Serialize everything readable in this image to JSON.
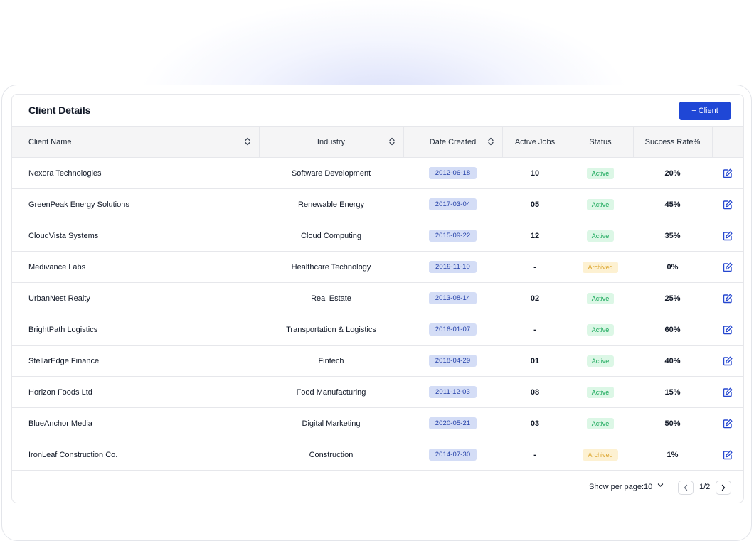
{
  "card": {
    "title": "Client Details",
    "add_button_label": "+ Client"
  },
  "columns": [
    "Client Name",
    "Industry",
    "Date Created",
    "Active Jobs",
    "Status",
    "Success Rate%"
  ],
  "rows": [
    {
      "name": "Nexora Technologies",
      "industry": "Software Development",
      "date": "2012-06-18",
      "jobs": "10",
      "status": "Active",
      "rate": "20%"
    },
    {
      "name": "GreenPeak Energy Solutions",
      "industry": "Renewable Energy",
      "date": "2017-03-04",
      "jobs": "05",
      "status": "Active",
      "rate": "45%"
    },
    {
      "name": "CloudVista Systems",
      "industry": "Cloud Computing",
      "date": "2015-09-22",
      "jobs": "12",
      "status": "Active",
      "rate": "35%"
    },
    {
      "name": "Medivance Labs",
      "industry": "Healthcare Technology",
      "date": "2019-11-10",
      "jobs": "-",
      "status": "Archived",
      "rate": "0%"
    },
    {
      "name": "UrbanNest Realty",
      "industry": "Real Estate",
      "date": "2013-08-14",
      "jobs": "02",
      "status": "Active",
      "rate": "25%"
    },
    {
      "name": "BrightPath Logistics",
      "industry": "Transportation & Logistics",
      "date": "2016-01-07",
      "jobs": "-",
      "status": "Active",
      "rate": "60%"
    },
    {
      "name": "StellarEdge Finance",
      "industry": "Fintech",
      "date": "2018-04-29",
      "jobs": "01",
      "status": "Active",
      "rate": "40%"
    },
    {
      "name": "Horizon Foods Ltd",
      "industry": "Food Manufacturing",
      "date": "2011-12-03",
      "jobs": "08",
      "status": "Active",
      "rate": "15%"
    },
    {
      "name": "BlueAnchor Media",
      "industry": "Digital Marketing",
      "date": "2020-05-21",
      "jobs": "03",
      "status": "Active",
      "rate": "50%"
    },
    {
      "name": "IronLeaf Construction Co.",
      "industry": "Construction",
      "date": "2014-07-30",
      "jobs": "-",
      "status": "Archived",
      "rate": "1%"
    }
  ],
  "pagination": {
    "per_page_label": "Show per page:",
    "per_page_value": "10",
    "page_indicator": "1/2"
  },
  "colors": {
    "primary": "#1f47d6",
    "active_bg": "#dcf7e6",
    "active_text": "#19a85a",
    "archived_bg": "#fdf1d2",
    "archived_text": "#dca630",
    "date_bg": "#d4ddf6",
    "date_text": "#2440a8"
  },
  "icons": {
    "sort": "sort-icon",
    "edit": "edit-icon",
    "per_page_dropdown": "chevron-down-icon",
    "prev": "chevron-left-icon",
    "next": "chevron-right-icon"
  }
}
